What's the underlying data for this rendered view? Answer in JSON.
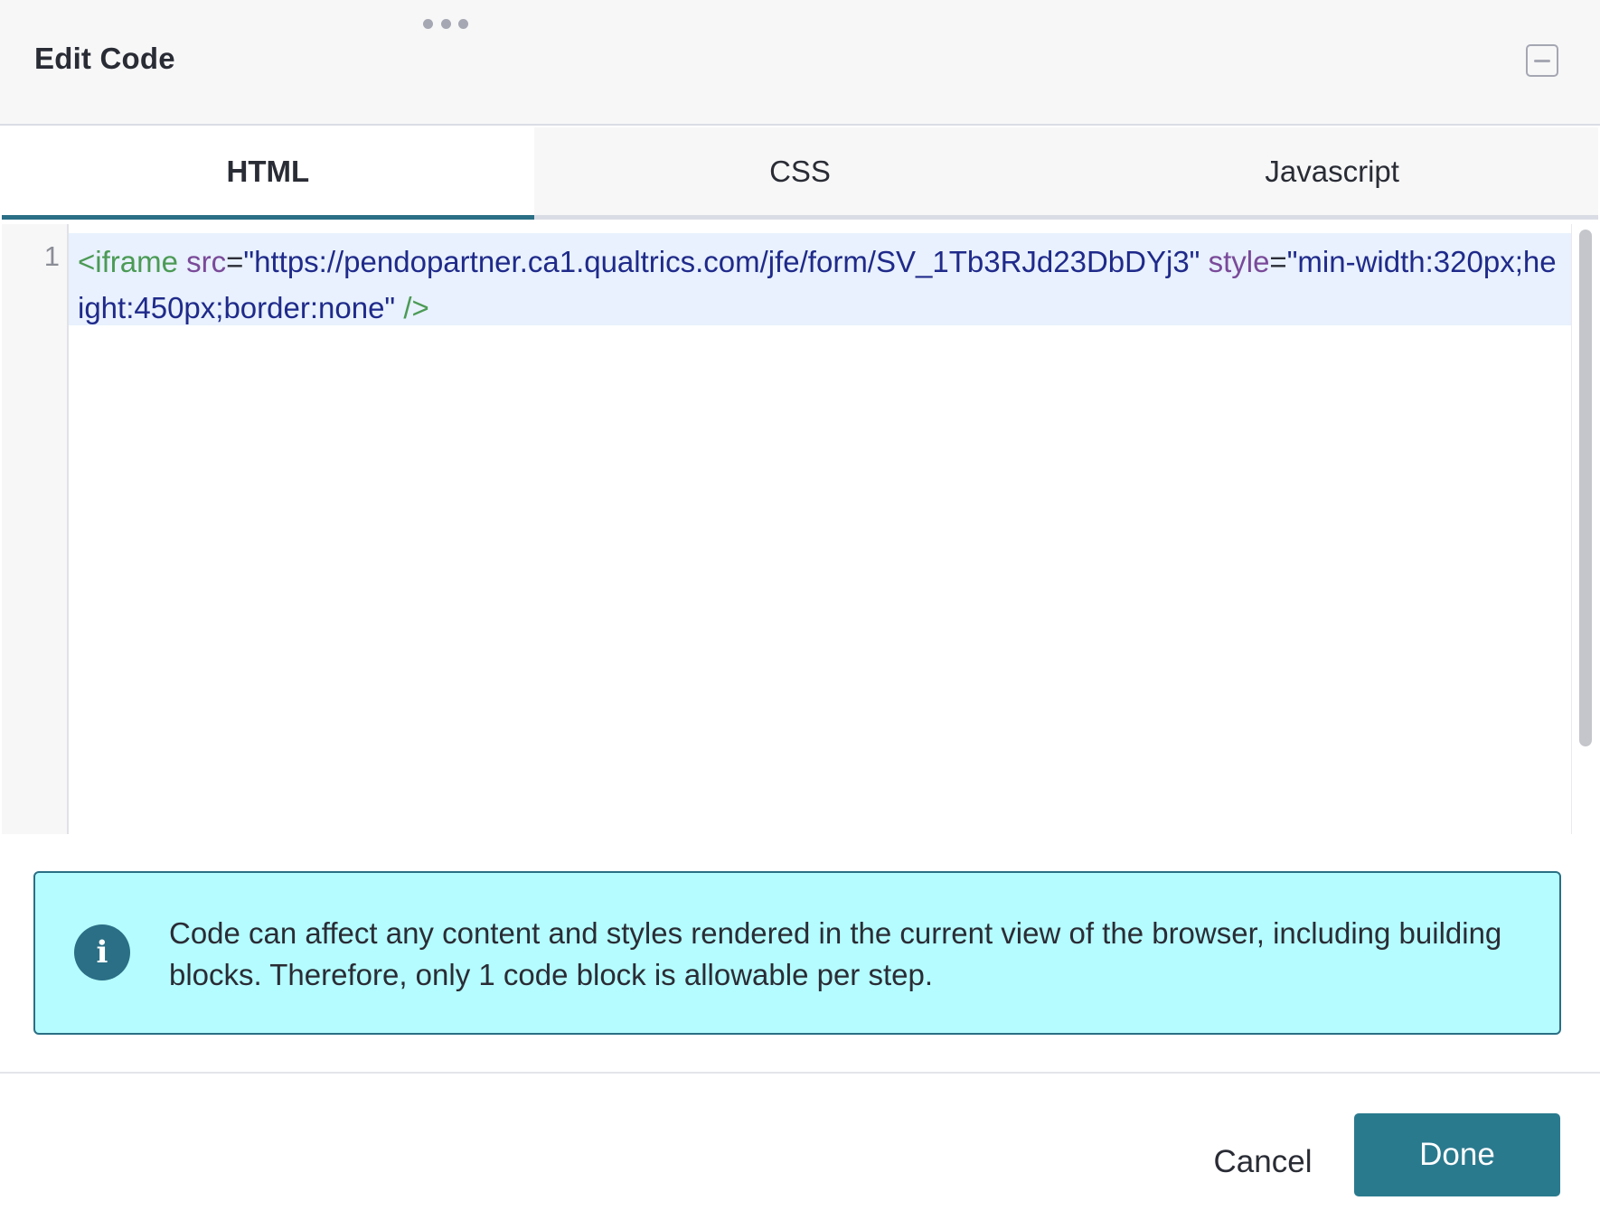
{
  "dialog": {
    "title": "Edit Code"
  },
  "tabs": [
    {
      "label": "HTML",
      "active": true
    },
    {
      "label": "CSS",
      "active": false
    },
    {
      "label": "Javascript",
      "active": false
    }
  ],
  "editor": {
    "line_number": "1",
    "tokens": {
      "tag_open": "<iframe",
      "attr_src": "src",
      "eq1": "=",
      "src_value": "\"https://pendopartner.ca1.qualtrics.com/jfe/form/SV_1Tb3RJd23DbDYj3\"",
      "attr_style": "style",
      "eq2": "=",
      "style_value": "\"min-width:320px;height:450px;border:none\"",
      "tag_close": "/>"
    }
  },
  "banner": {
    "icon": "info-icon",
    "icon_glyph": "i",
    "text": "Code can affect any content and styles rendered in the current view of the browser, including building blocks. Therefore, only 1 code block is allowable per step."
  },
  "footer": {
    "cancel_label": "Cancel",
    "done_label": "Done"
  },
  "colors": {
    "accent": "#2a7a8e",
    "banner_bg": "#b4fcff",
    "tag": "#4b9a55",
    "attribute": "#7a4a99",
    "string": "#1f2a8a",
    "line_highlight": "#e8f1fd"
  }
}
